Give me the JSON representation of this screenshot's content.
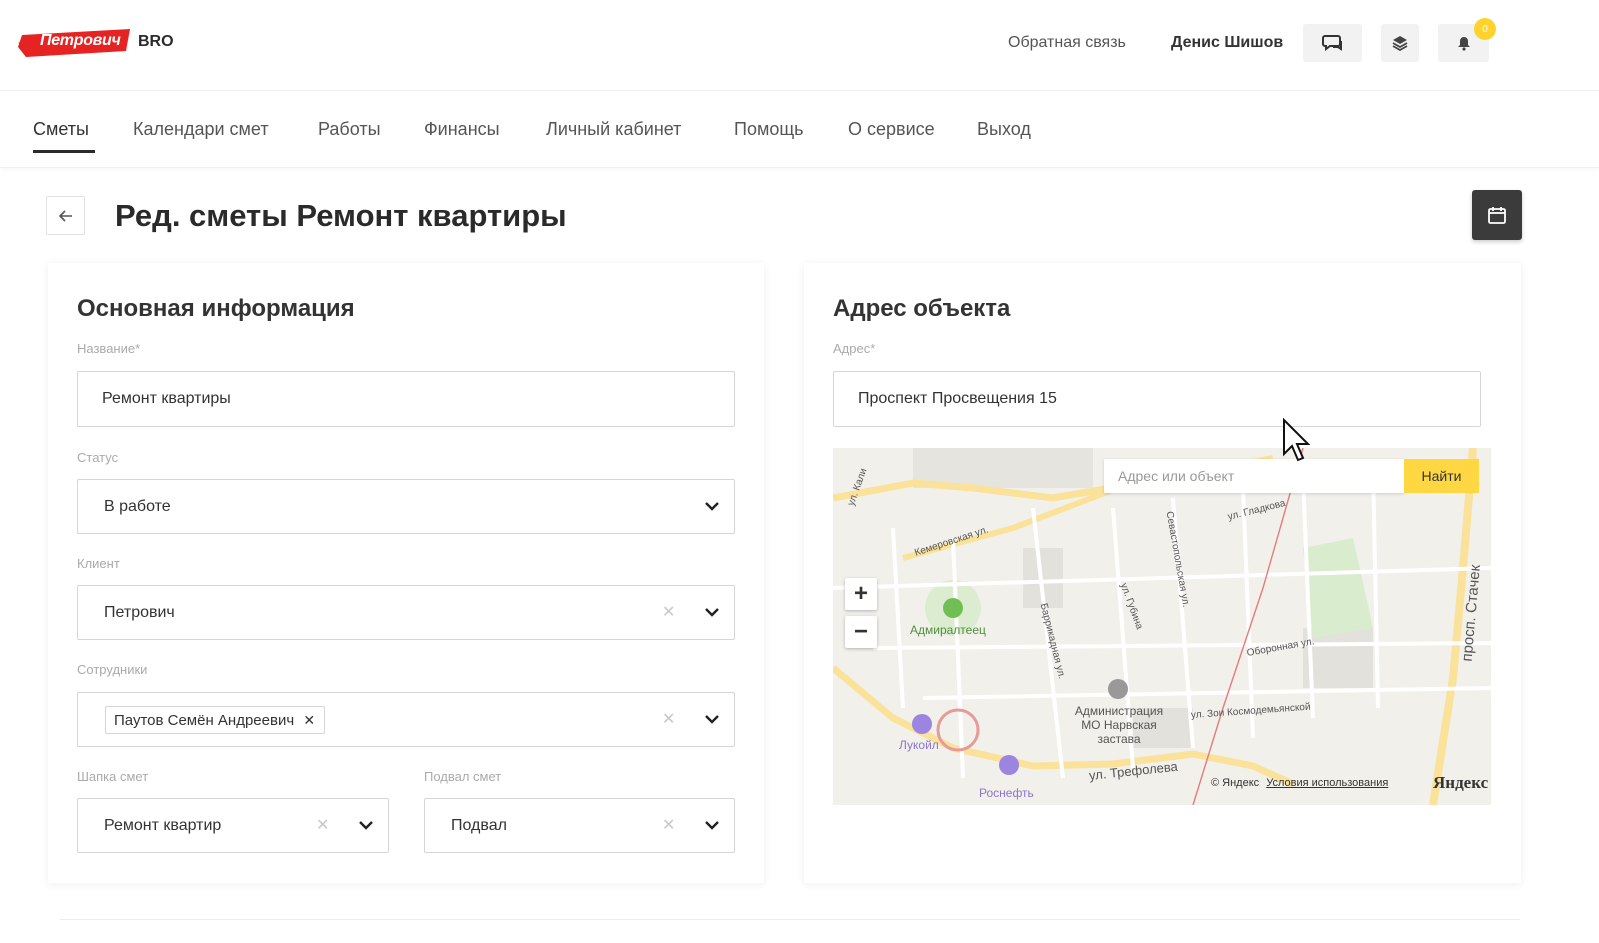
{
  "brand": {
    "name": "Петрович",
    "suffix": "BRO",
    "brand_color": "#e42322"
  },
  "header": {
    "feedback_link": "Обратная связь",
    "user_name": "Денис Шишов",
    "notification_count": "0",
    "icons": [
      "chat-icon",
      "layers-icon",
      "bell-icon"
    ]
  },
  "nav": {
    "items": [
      {
        "label": "Сметы",
        "active": true
      },
      {
        "label": "Календари смет"
      },
      {
        "label": "Работы"
      },
      {
        "label": "Финансы"
      },
      {
        "label": "Личный кабинет"
      },
      {
        "label": "Помощь"
      },
      {
        "label": "О сервисе"
      },
      {
        "label": "Выход"
      }
    ]
  },
  "page": {
    "title": "Ред. сметы Ремонт квартиры"
  },
  "main_info": {
    "title": "Основная информация",
    "name_label": "Название*",
    "name_value": "Ремонт квартиры",
    "status_label": "Статус",
    "status_value": "В работе",
    "client_label": "Клиент",
    "client_value": "Петрович",
    "employees_label": "Сотрудники",
    "employee_chip": "Паутов Семён Андреевич",
    "header_label": "Шапка смет",
    "header_value": "Ремонт квартир",
    "footer_label": "Подвал смет",
    "footer_value": "Подвал"
  },
  "address": {
    "title": "Адрес объекта",
    "address_label": "Адрес*",
    "address_value": "Проспект Просвещения 15",
    "map": {
      "search_placeholder": "Адрес или объект",
      "find_button": "Найти",
      "copyright": "© Яндекс",
      "terms": "Условия использования",
      "brand": "Яндекс",
      "pois": [
        "Адмиралтеец",
        "Администрация МО Нарвская застава",
        "Лукойл",
        "Роснефть"
      ],
      "streets": [
        "Кемеровская ул.",
        "ул. Гладкова",
        "Севастопольская ул.",
        "ул. Губина",
        "Баррикадная ул.",
        "Оборонная ул.",
        "ул. Зои Космодемьянской",
        "ул. Трефолева",
        "просп. Стачек",
        "ул. Кали"
      ]
    }
  }
}
